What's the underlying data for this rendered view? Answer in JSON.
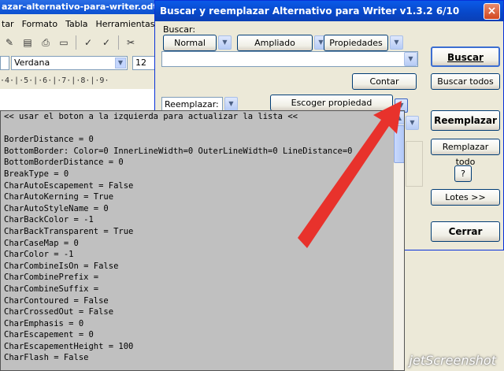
{
  "writer": {
    "title": "azar-alternativo-para-writer.odt - O",
    "menu": [
      "tar",
      "Formato",
      "Tabla",
      "Herramientas"
    ],
    "font_name": "Verdana",
    "font_size": "12",
    "ruler": "·4·|·5·|·6·|·7·|·8·|·9·"
  },
  "dialog": {
    "title": "Buscar y reemplazar Alternativo para Writer v1.3.2  6/10",
    "close": "×",
    "buscar_label": "Buscar:",
    "mode_normal": "Normal",
    "mode_ampliado": "Ampliado",
    "mode_propiedades": "Propiedades",
    "buscar_button": "Buscar",
    "buscar_todos_button": "Buscar todos",
    "contar_button": "Contar",
    "reemplazar_label": "Reemplazar:",
    "escoger_propiedad_button": "Escoger propiedad",
    "reemplazar_button": "Reemplazar",
    "reemplazar_todo_button": "Remplazar todo",
    "help_button": "?",
    "lotes_button": "Lotes >>",
    "cerrar_button": "Cerrar"
  },
  "property_list": [
    "<< usar el boton a la izquierda para actualizar la lista <<",
    "",
    "BorderDistance = 0",
    "BottomBorder: Color=0 InnerLineWidth=0 OuterLineWidth=0 LineDistance=0",
    "BottomBorderDistance = 0",
    "BreakType = 0",
    "CharAutoEscapement = False",
    "CharAutoKerning = True",
    "CharAutoStyleName = 0",
    "CharBackColor = -1",
    "CharBackTransparent = True",
    "CharCaseMap = 0",
    "CharColor = -1",
    "CharCombineIsOn = False",
    "CharCombinePrefix =",
    "CharCombineSuffix =",
    "CharContoured = False",
    "CharCrossedOut = False",
    "CharEmphasis = 0",
    "CharEscapement = 0",
    "CharEscapementHeight = 100",
    "CharFlash = False"
  ],
  "watermark": "jetScreenshot",
  "colors": {
    "arrow": "#e8322c",
    "title_bar": "#0a4fd0",
    "list_bg": "#c0c0c0"
  }
}
